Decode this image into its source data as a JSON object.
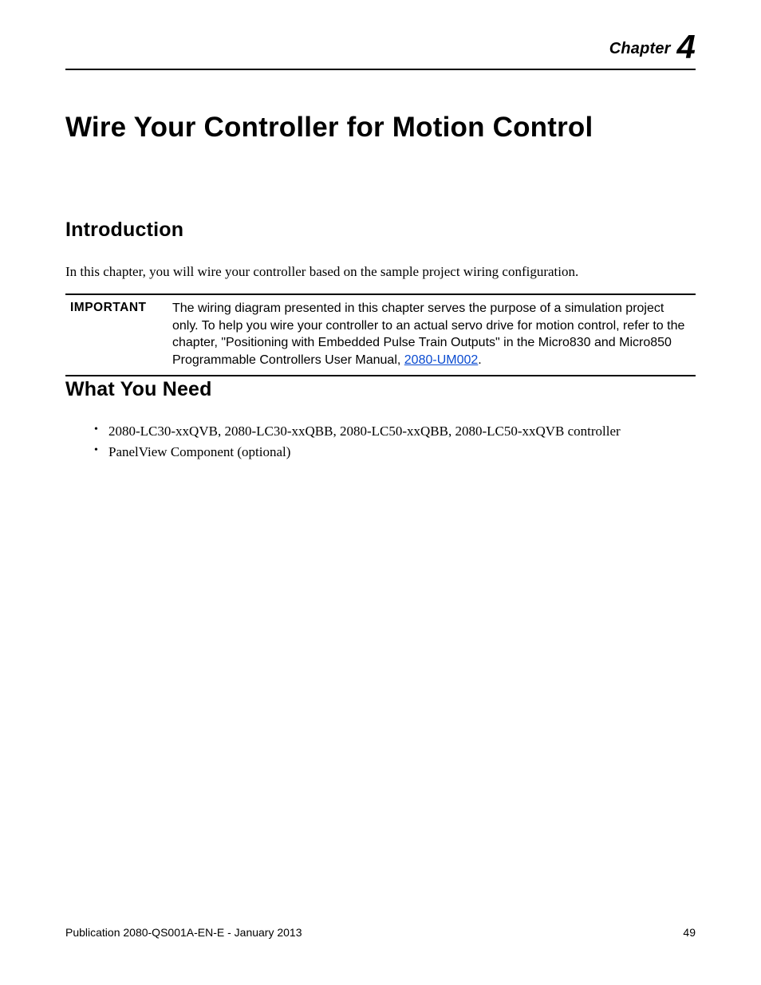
{
  "header": {
    "chapter_word": "Chapter",
    "chapter_number": "4"
  },
  "title": "Wire Your Controller for Motion Control",
  "sections": {
    "introduction": {
      "heading": "Introduction",
      "paragraph": "In this chapter, you will wire your controller based on the sample project wiring configuration."
    },
    "important": {
      "label": "IMPORTANT",
      "text_before_link": "The wiring diagram presented in this chapter serves the purpose of a simulation project only. To help you wire your controller to an actual servo drive for motion control, refer to the chapter, \"Positioning with Embedded Pulse Train Outputs\" in the Micro830 and Micro850 Programmable Controllers User Manual, ",
      "link_text": "2080-UM002",
      "text_after_link": "."
    },
    "what_you_need": {
      "heading": "What You Need",
      "items": [
        "2080-LC30-xxQVB, 2080-LC30-xxQBB, 2080-LC50-xxQBB, 2080-LC50-xxQVB controller",
        "PanelView Component (optional)"
      ]
    }
  },
  "footer": {
    "publication": "Publication 2080-QS001A-EN-E - January 2013",
    "page_number": "49"
  }
}
